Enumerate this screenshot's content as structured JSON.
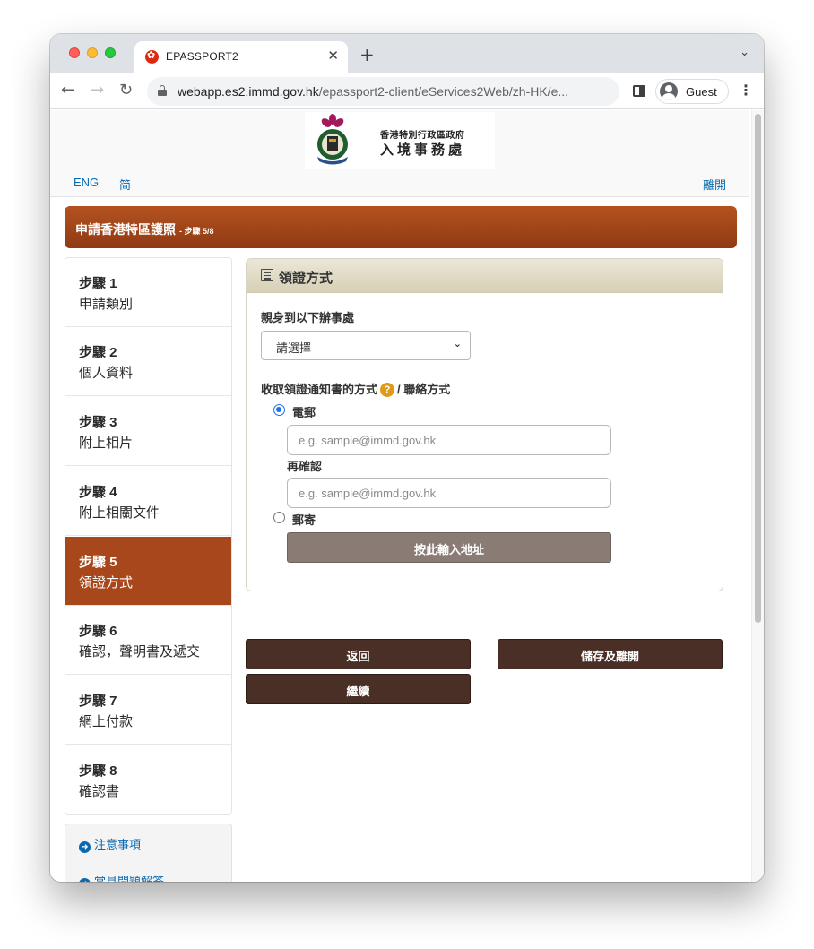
{
  "browser": {
    "tab_title": "EPASSPORT2",
    "url_host": "webapp.es2.immd.gov.hk",
    "url_path": "/epassport2-client/eServices2Web/zh-HK/e...",
    "profile_label": "Guest"
  },
  "header": {
    "logo_line1": "香港特別行政區政府",
    "logo_line2": "入境事務處",
    "lang_eng": "ENG",
    "lang_sc": "简",
    "exit": "離開"
  },
  "banner": {
    "title": "申請香港特區護照",
    "step_indicator": "- 步驟 5/8"
  },
  "steps": [
    {
      "num": "步驟 1",
      "name": "申請類別"
    },
    {
      "num": "步驟 2",
      "name": "個人資料"
    },
    {
      "num": "步驟 3",
      "name": "附上相片"
    },
    {
      "num": "步驟 4",
      "name": "附上相關文件"
    },
    {
      "num": "步驟 5",
      "name": "領證方式"
    },
    {
      "num": "步驟 6",
      "name": "確認，聲明書及遞交"
    },
    {
      "num": "步驟 7",
      "name": "網上付款"
    },
    {
      "num": "步驟 8",
      "name": "確認書"
    }
  ],
  "active_step": 5,
  "info_links": {
    "notes": "注意事項",
    "faq": "常見問題解答"
  },
  "panel": {
    "title": "領證方式",
    "office_label": "親身到以下辦事處",
    "office_select_value": "請選擇",
    "notice_label_a": "收取領證通知書的方式",
    "notice_label_b": "/ 聯絡方式",
    "option_email": "電郵",
    "email_placeholder": "e.g. sample@immd.gov.hk",
    "confirm_label": "再確認",
    "confirm_placeholder": "e.g. sample@immd.gov.hk",
    "option_post": "郵寄",
    "address_button": "按此輸入地址"
  },
  "actions": {
    "back": "返回",
    "save_exit": "儲存及離開",
    "continue": "繼續"
  },
  "colors": {
    "banner": "#a8471b",
    "active_step": "#a8471b",
    "action_button": "#4a2f27",
    "link": "#0a6ab0",
    "help": "#e09a17"
  }
}
